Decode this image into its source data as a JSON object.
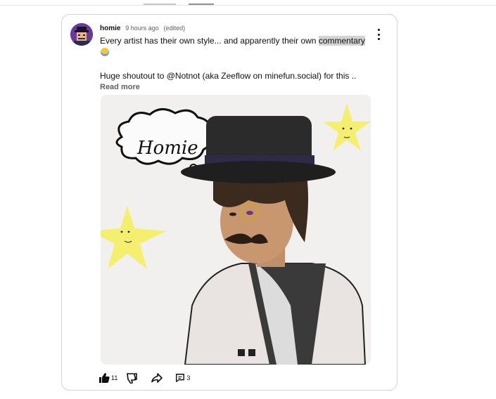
{
  "comment": {
    "author": "homie",
    "time": "9 hours ago",
    "edited": "(edited)",
    "text_before_highlight": "Every artist has their own style... and apparently their own ",
    "text_highlight": "commentary",
    "text_line2": "Huge shoutout to @Notnot (aka Zeeflow on minefun.social) for this ..",
    "read_more": "Read more"
  },
  "artwork": {
    "bubble_text": "Homie"
  },
  "actions": {
    "like_count": "11",
    "reply_count": "3"
  },
  "icons": [
    "kebab-menu-icon",
    "thumbs-up-icon",
    "thumbs-down-icon",
    "share-icon",
    "comment-icon"
  ],
  "colors": {
    "text": "#0f0f0f",
    "secondary": "#606060",
    "highlight": "#d3d3d3",
    "border": "#d3d3d3"
  }
}
